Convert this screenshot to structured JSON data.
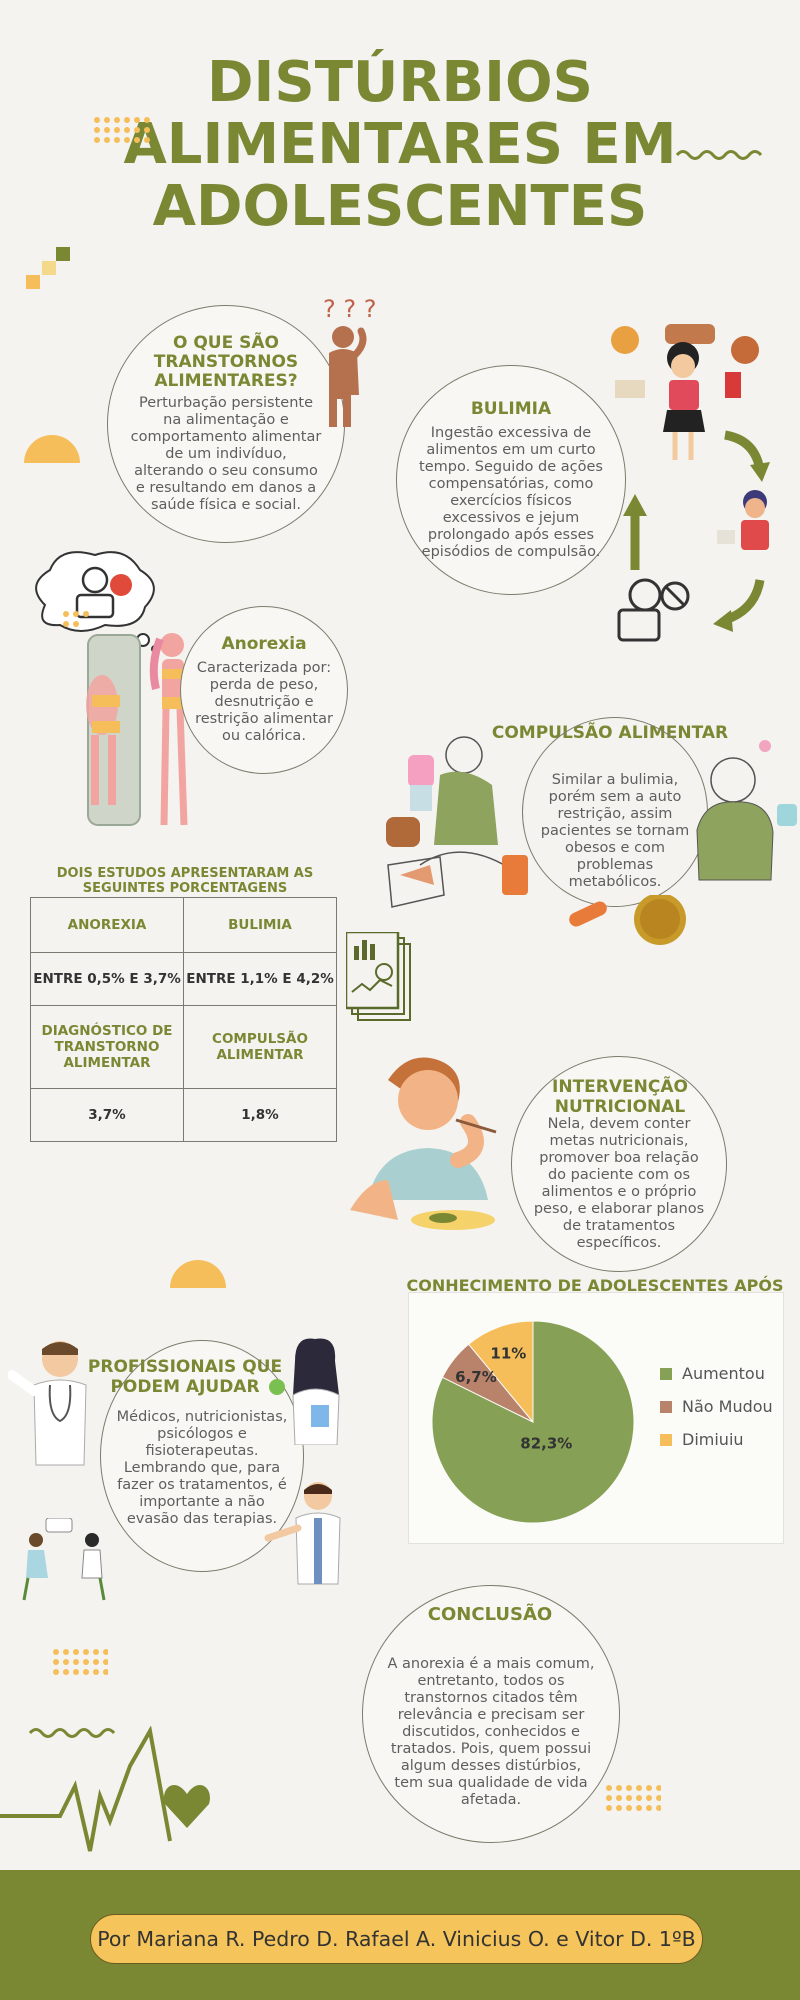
{
  "title": {
    "line1": "DISTÚRBIOS",
    "line2": "ALIMENTARES EM",
    "line3": "ADOLESCENTES"
  },
  "o_que_sao": {
    "heading": "O QUE SÃO TRANSTORNOS ALIMENTARES?",
    "text": "Perturbação persistente na alimentação e comportamento alimentar de um indivíduo, alterando o seu consumo e resultando em danos a saúde física e social."
  },
  "bulimia": {
    "heading": "BULIMIA",
    "text": "Ingestão excessiva de alimentos em um curto tempo. Seguido de ações compensatórias, como exercícios físicos excessivos e jejum prolongado após esses episódios de compulsão."
  },
  "anorexia": {
    "heading": "Anorexia",
    "text": "Caracterizada por: perda de peso, desnutrição e restrição alimentar ou calórica."
  },
  "compulsao": {
    "heading": "COMPULSÃO ALIMENTAR",
    "text": "Similar a bulimia, porém sem a auto restrição, assim pacientes se tornam obesos e com problemas metabólicos."
  },
  "estudos": {
    "heading": "DOIS ESTUDOS APRESENTARAM AS SEGUINTES PORCENTAGENS",
    "rows": [
      {
        "h1": "ANOREXIA",
        "h2": "BULIMIA",
        "v1": "ENTRE 0,5% E 3,7%",
        "v2": "ENTRE 1,1% E 4,2%"
      },
      {
        "h1": "DIAGNÓSTICO DE TRANSTORNO ALIMENTAR",
        "h2": "COMPULSÃO ALIMENTAR",
        "v1": "3,7%",
        "v2": "1,8%"
      }
    ]
  },
  "intervencao": {
    "heading": "INTERVENÇÃO NUTRICIONAL",
    "text": "Nela, devem conter metas nutricionais, promover boa relação do paciente com os alimentos e o próprio peso, e elaborar planos de tratamentos específicos."
  },
  "profissionais": {
    "heading": "PROFISSIONAIS QUE PODEM AJUDAR",
    "text": "Médicos, nutricionistas, psicólogos e fisioterapeutas. Lembrando que, para fazer os tratamentos, é importante a não evasão das terapias."
  },
  "conclusao": {
    "heading": "CONCLUSÃO",
    "text": "A anorexia é a mais comum, entretanto, todos os transtornos citados têm relevância e precisam ser discutidos, conhecidos e tratados. Pois, quem possui algum desses distúrbios, tem sua qualidade de vida afetada."
  },
  "chart_data": {
    "type": "pie",
    "title": "CONHECIMENTO DE ADOLESCENTES APÓS UMA INTERVENÇÃO NUTRICIONAL",
    "categories": [
      "Aumentou",
      "Não Mudou",
      "Dimiuiu"
    ],
    "values": [
      82.3,
      6.7,
      11
    ],
    "labels": [
      "82,3%",
      "6,7%",
      "11%"
    ],
    "colors": [
      "#86a055",
      "#b9826a",
      "#f5be5a"
    ],
    "legend_position": "right"
  },
  "footer": {
    "credits": "Por Mariana R. Pedro D. Rafael A. Vinicius O. e Vitor D. 1ºB"
  },
  "icons": [
    "question-marks-icon",
    "heart-icon",
    "heartbeat-line-icon",
    "report-document-icon"
  ]
}
